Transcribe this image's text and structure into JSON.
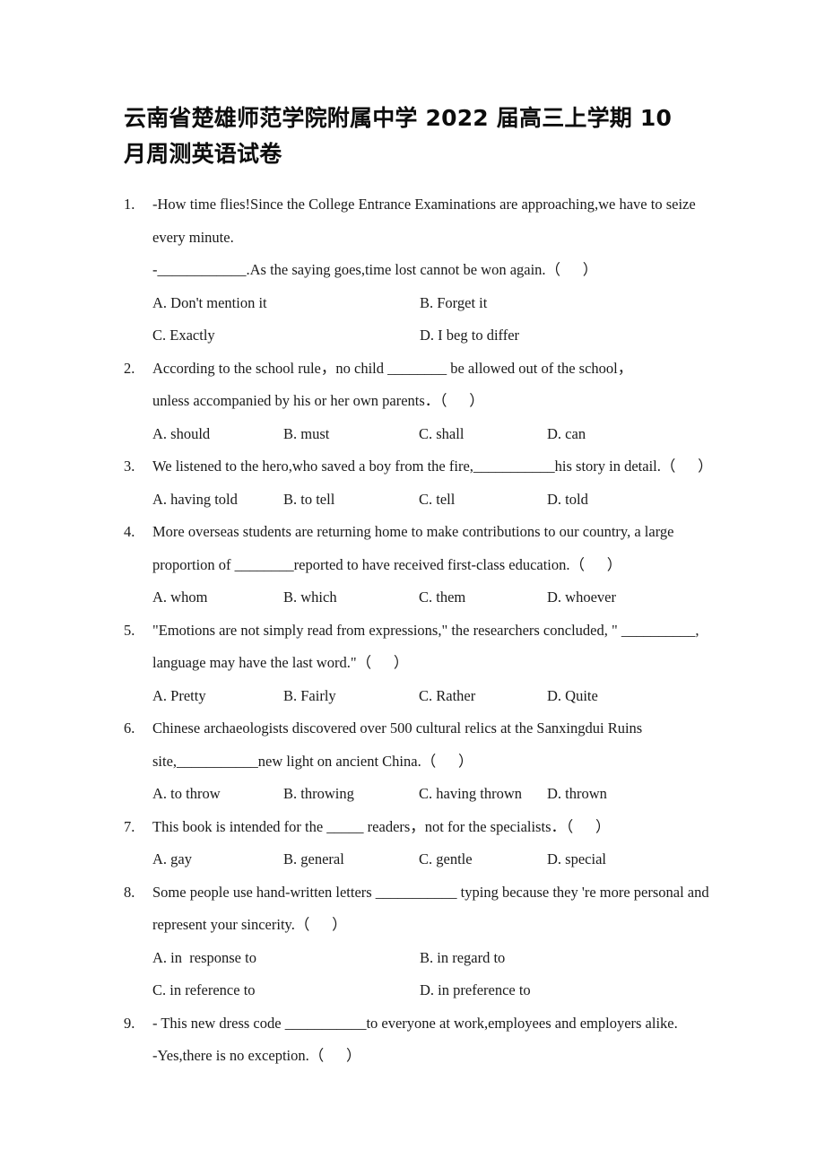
{
  "document": {
    "title": "云南省楚雄师范学院附属中学 2022 届高三上学期 10 月周测英语试卷"
  },
  "questions": [
    {
      "number": "1.",
      "lines": [
        "-How time flies!Since the College Entrance Examinations are approaching,we have to seize",
        "every minute.",
        "-____________.As the saying goes,time lost cannot be won again.（      ）"
      ],
      "layout": "cols2",
      "options": [
        "A. Don't mention it",
        "B. Forget it",
        "C. Exactly",
        "D. I beg to differ"
      ]
    },
    {
      "number": "2.",
      "lines": [
        "According to the school rule，no child ________ be allowed out of the school，",
        "unless accompanied by his or her own parents．（      ）"
      ],
      "layout": "cols4",
      "options": [
        "A. should",
        "B. must",
        "C. shall",
        "D. can"
      ]
    },
    {
      "number": "3.",
      "lines": [
        "We listened to the hero,who saved a boy from the fire,___________his story in detail.（      ）"
      ],
      "layout": "cols4",
      "options": [
        "A. having told",
        "B. to tell",
        "C. tell",
        "D. told"
      ]
    },
    {
      "number": "4.",
      "lines": [
        "More overseas students are returning home to make contributions to our country, a large",
        "proportion of ________reported to have received first-class education.（      ）"
      ],
      "layout": "cols4",
      "options": [
        "A. whom",
        "B. which",
        "C. them",
        "D. whoever"
      ]
    },
    {
      "number": "5.",
      "lines": [
        "\"Emotions are not simply read from expressions,\" the researchers concluded, \" __________,",
        "language may have the last word.\"（      ）"
      ],
      "layout": "cols4",
      "options": [
        "A. Pretty",
        "B. Fairly",
        "C. Rather",
        "D. Quite"
      ]
    },
    {
      "number": "6.",
      "lines": [
        "Chinese archaeologists discovered over 500 cultural relics at the Sanxingdui Ruins",
        "site,___________new light on ancient China.（      ）"
      ],
      "layout": "cols4",
      "options": [
        "A. to throw",
        "B. throwing",
        "C. having thrown",
        "D. thrown"
      ]
    },
    {
      "number": "7.",
      "lines": [
        "This book is intended for the _____ readers，not for the specialists．（      ）"
      ],
      "layout": "cols4",
      "options": [
        "A. gay",
        "B. general",
        "C. gentle",
        "D. special"
      ]
    },
    {
      "number": "8.",
      "lines": [
        "Some people use hand-written letters ___________ typing because they 're more personal and",
        "represent your sincerity.（      ）"
      ],
      "layout": "cols2",
      "options": [
        "A. in  response to",
        "B. in regard to",
        "C. in reference to",
        "D. in preference to"
      ]
    },
    {
      "number": "9.",
      "lines": [
        "- This new dress code ___________to everyone at work,employees and employers alike.",
        "-Yes,there is no exception.（      ）"
      ],
      "layout": "none",
      "options": []
    }
  ]
}
